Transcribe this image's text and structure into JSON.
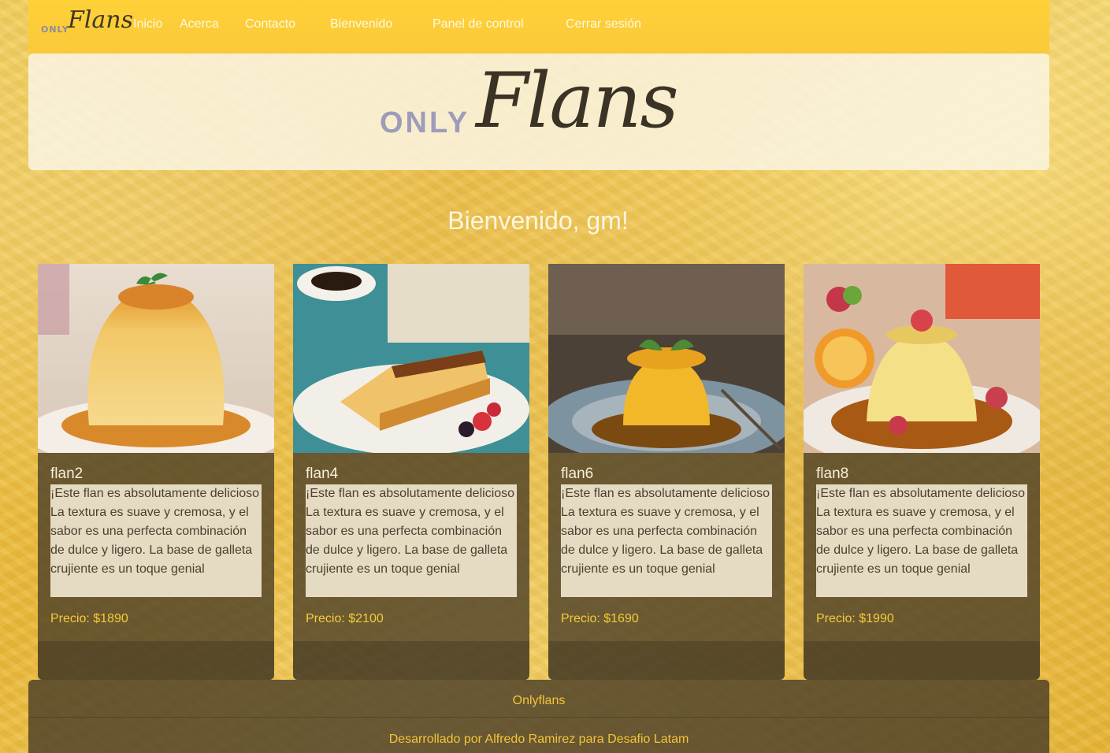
{
  "nav": {
    "logo_only": "ONLY",
    "logo_flans": "Flans",
    "links": [
      "Inicio",
      "Acerca",
      "Contacto",
      "Bienvenido",
      "Panel de control",
      "Cerrar sesión"
    ]
  },
  "banner": {
    "logo_only": "ONLY",
    "logo_flans": "Flans"
  },
  "welcome": "Bienvenido, gm!",
  "cards": [
    {
      "title": "flan2",
      "description": "¡Este flan es absolutamente delicioso La textura es suave y cremosa, y el sabor es una perfecta combinación de dulce y ligero. La base de galleta crujiente es un toque genial",
      "price": "Precio: $1890"
    },
    {
      "title": "flan4",
      "description": "¡Este flan es absolutamente delicioso La textura es suave y cremosa, y el sabor es una perfecta combinación de dulce y ligero. La base de galleta crujiente es un toque genial",
      "price": "Precio: $2100"
    },
    {
      "title": "flan6",
      "description": "¡Este flan es absolutamente delicioso La textura es suave y cremosa, y el sabor es una perfecta combinación de dulce y ligero. La base de galleta crujiente es un toque genial",
      "price": "Precio: $1690"
    },
    {
      "title": "flan8",
      "description": "¡Este flan es absolutamente delicioso La textura es suave y cremosa, y el sabor es una perfecta combinación de dulce y ligero. La base de galleta crujiente es un toque genial",
      "price": "Precio: $1990"
    }
  ],
  "footer": {
    "brand": "Onlyflans",
    "credit": "Desarrollado por Alfredo Ramirez para Desafio Latam"
  },
  "colors": {
    "navbar": "#ffd137",
    "price": "#f4cc3c",
    "footer_text": "#f4c43a",
    "card_bg": "#4b3e28"
  }
}
